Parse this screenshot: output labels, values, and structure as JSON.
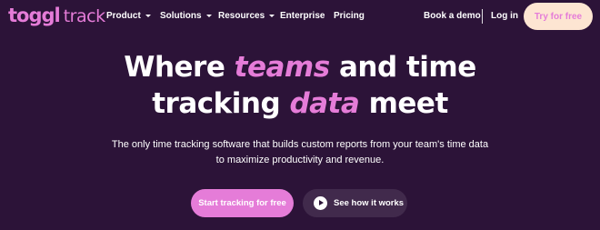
{
  "logo": {
    "brand": "toggl",
    "product": "track"
  },
  "nav": {
    "product": "Product",
    "solutions": "Solutions",
    "resources": "Resources",
    "enterprise": "Enterprise",
    "pricing": "Pricing",
    "book_demo": "Book a demo",
    "login": "Log in",
    "try_free": "Try for free"
  },
  "hero": {
    "title_1": "Where ",
    "title_teams": "teams",
    "title_2": " and time",
    "title_3": "tracking ",
    "title_data": "data",
    "title_4": " meet",
    "subtitle_line1": "The only time tracking software that builds custom reports from your team's time data",
    "subtitle_line2": "to maximize productivity and revenue.",
    "cta_primary": "Start tracking for free",
    "cta_secondary": "See how it works"
  },
  "colors": {
    "background": "#2c1338",
    "accent_pink": "#e57cd8",
    "try_button_bg": "#fde5d2",
    "secondary_button_bg": "#412a4c"
  },
  "icons": {
    "dropdown": "chevron-down-icon",
    "play": "play-icon"
  }
}
